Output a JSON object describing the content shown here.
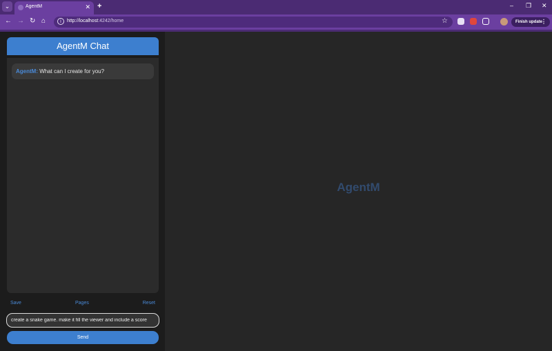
{
  "browser": {
    "tab_title": "AgentM",
    "url_host": "http://localhost",
    "url_rest": ":4242/home",
    "finish_update_label": "Finish update",
    "icons": {
      "tab_menu": "chevron-down-icon",
      "close": "close-icon",
      "new_tab": "plus-icon",
      "back": "arrow-left-icon",
      "forward": "arrow-right-icon",
      "reload": "reload-icon",
      "home": "home-icon",
      "site_info": "info-icon",
      "bookmark": "star-icon",
      "extensions": "puzzle-icon",
      "menu": "kebab-menu-icon"
    },
    "colors": {
      "tab_bar": "#4b2b73",
      "toolbar": "#6b3fa0",
      "omnibox": "#4e2b7c"
    }
  },
  "chat": {
    "title": "AgentM Chat",
    "messages": [
      {
        "sender": "AgentM:",
        "text": " What can I create for you?"
      }
    ],
    "links": {
      "save": "Save",
      "pages": "Pages",
      "reset": "Reset"
    },
    "input_value": "create a snake game. make it fill the viewer and include a score",
    "send_label": "Send",
    "colors": {
      "accent": "#3d7fcf",
      "sender": "#4a8ad8"
    }
  },
  "viewer": {
    "title": "AgentM"
  }
}
